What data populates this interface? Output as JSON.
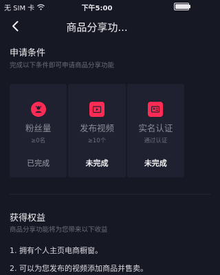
{
  "status_bar": {
    "carrier": "无 SIM 卡",
    "time": "下午5:00",
    "wifi_icon": "wifi-icon",
    "battery_icon": "battery-icon",
    "battery_level": 0.95
  },
  "nav": {
    "title": "商品分享功...",
    "back_icon": "chevron-left-icon"
  },
  "requirements": {
    "title": "申请条件",
    "subtitle": "完成以下条件即可申请商品分享功能",
    "cards": [
      {
        "icon": "fans-icon",
        "name": "粉丝量",
        "requirement": "≥0名",
        "status": "已完成",
        "done": true
      },
      {
        "icon": "video-icon",
        "name": "发布视频",
        "requirement": "≥10个",
        "status": "未完成",
        "done": false
      },
      {
        "icon": "id-card-icon",
        "name": "实名认证",
        "requirement": "通过认证",
        "status": "未完成",
        "done": false
      }
    ]
  },
  "benefits": {
    "title": "获得权益",
    "subtitle": "商品分享功能将为您带来以下收益",
    "items": [
      "1. 拥有个人主页电商橱窗。",
      "2. 可以为您发布的视频添加商品并售卖。"
    ]
  },
  "colors": {
    "background": "#161823",
    "card_background": "#1f2130",
    "accent": "#fe2c55"
  }
}
